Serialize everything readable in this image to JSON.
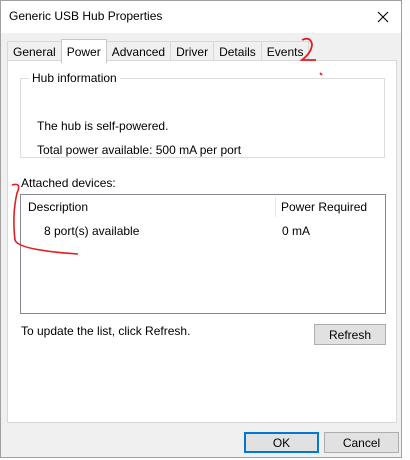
{
  "window": {
    "title": "Generic USB Hub Properties"
  },
  "tabs": [
    {
      "label": "General",
      "active": false
    },
    {
      "label": "Power",
      "active": true
    },
    {
      "label": "Advanced",
      "active": false
    },
    {
      "label": "Driver",
      "active": false
    },
    {
      "label": "Details",
      "active": false
    },
    {
      "label": "Events",
      "active": false
    }
  ],
  "hub_info": {
    "legend": "Hub information",
    "line1": "The hub is self-powered.",
    "line2": "Total power available:  500 mA per port"
  },
  "attached": {
    "label": "Attached devices:",
    "columns": [
      "Description",
      "Power Required"
    ],
    "rows": [
      {
        "description": "8 port(s) available",
        "power": "0 mA"
      }
    ]
  },
  "update_note": "To update the list, click Refresh.",
  "buttons": {
    "refresh": "Refresh",
    "ok": "OK",
    "cancel": "Cancel"
  },
  "icons": {
    "close": "close-icon"
  },
  "colors": {
    "annotation": "#e02020",
    "ok_border": "#0078d7"
  }
}
